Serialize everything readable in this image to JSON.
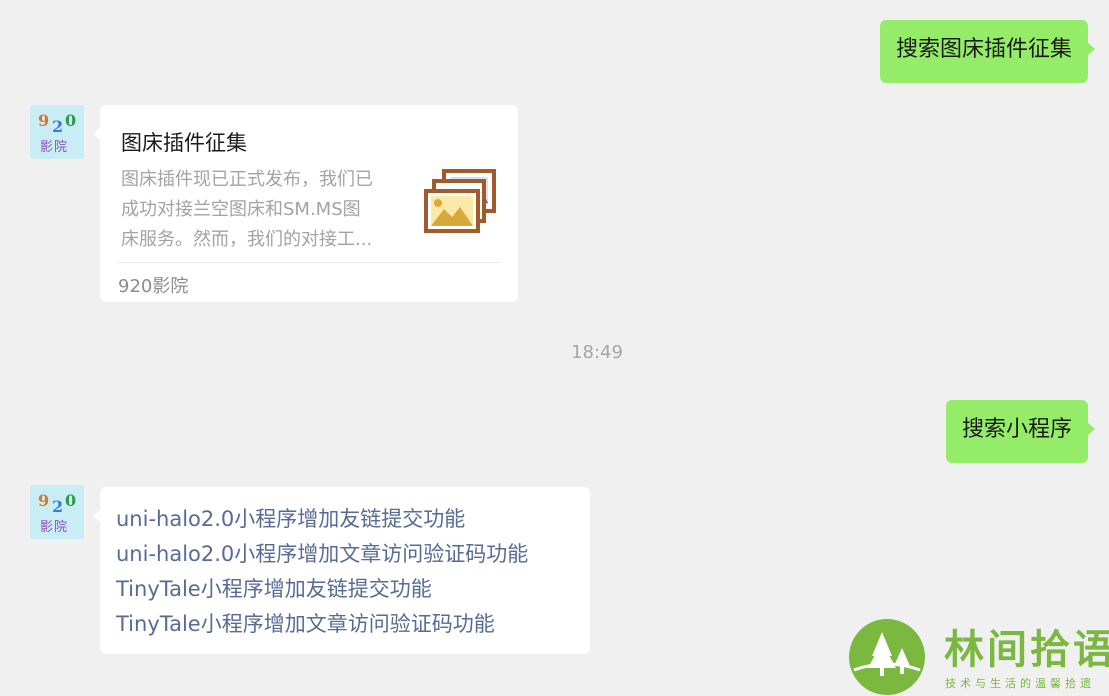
{
  "messages": {
    "out1": {
      "text": "搜索图床插件征集"
    },
    "card": {
      "title": "图床插件征集",
      "desc_lines": [
        "图床插件现已正式发布，我们已",
        "成功对接兰空图床和SM.MS图",
        "床服务。然而，我们的对接工..."
      ],
      "source": "920影院",
      "thumb_icon": "image-gallery-icon"
    },
    "timestamp": "18:49",
    "out2": {
      "text": "搜索小程序"
    },
    "links": [
      "uni-halo2.0小程序增加友链提交功能",
      "uni-halo2.0小程序增加文章访问验证码功能",
      "TinyTale小程序增加友链提交功能",
      "TinyTale小程序增加文章访问验证码功能"
    ]
  },
  "avatar": {
    "digits": [
      "9",
      "2",
      "0"
    ],
    "label": "影院"
  },
  "watermark": {
    "title": "林间拾语",
    "subtitle": "技术与生活的温馨拾遗"
  },
  "colors": {
    "background": "#f0f0f0",
    "outgoing_bubble": "#95ec69",
    "incoming_bubble": "#ffffff",
    "link": "#576b95",
    "watermark_green": "#7ab83f"
  }
}
